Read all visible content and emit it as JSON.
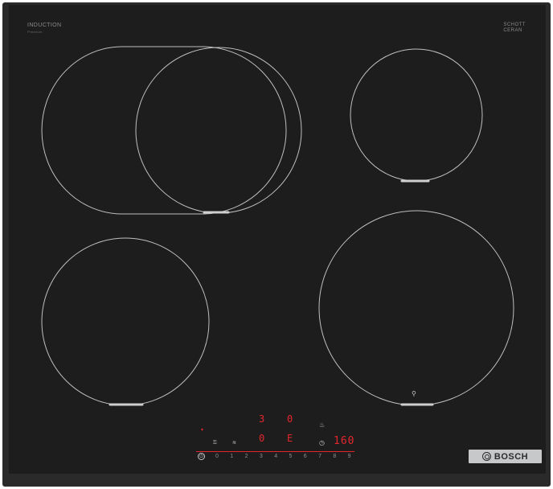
{
  "cooktop": {
    "top_left_label": "INDUCTION",
    "top_left_sublabel": "Premium",
    "top_right_label_line1": "SCHOTT",
    "top_right_label_line2": "CERAN",
    "brand": "BOSCH",
    "colors": {
      "glass": "#1d1d1e",
      "frame": "#2a2a2b",
      "zone_outline": "#bfbfbf",
      "display_red": "#e4262c",
      "badge": "#c7c8ca"
    }
  },
  "displays": {
    "zone_rear_left": "3",
    "zone_rear_right": "0",
    "zone_front_left": "0",
    "zone_front_right": "E",
    "timer": "160"
  },
  "power_scale": [
    "0",
    "1",
    "2",
    "3",
    "4",
    "5",
    "6",
    "7",
    "8",
    "9"
  ],
  "icons": {
    "power": "power-icon",
    "timer": "timer-icon",
    "pan_sensor": "pan-icon",
    "child_lock": "lock-icon",
    "wipe_protect": "wipe-icon"
  }
}
